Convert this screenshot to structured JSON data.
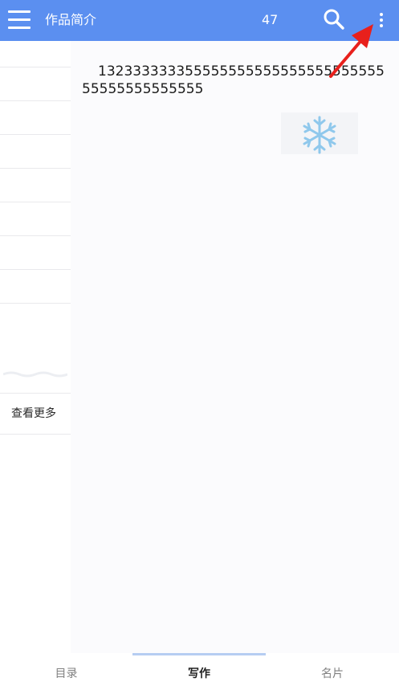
{
  "header": {
    "title": "作品简介",
    "count": "47",
    "menu_icon": "menu-icon",
    "search_icon": "search-icon",
    "more_icon": "more-vertical-icon",
    "bg_color": "#5b8ff0"
  },
  "toc": {
    "more_label": "查看更多",
    "row_count_visible": 8
  },
  "content": {
    "text": "13233333335555555555555555555555555555555555555",
    "decoration_icon": "snowflake-icon",
    "annotation": "red-arrow-pointing-to-more-icon"
  },
  "tabs": [
    {
      "label": "目录",
      "active": false
    },
    {
      "label": "写作",
      "active": true
    },
    {
      "label": "名片",
      "active": false
    }
  ],
  "colors": {
    "accent": "#5b8ff0",
    "tab_active_text": "#1f1f1f",
    "tab_inactive_text": "#808080",
    "arrow": "#e8201c"
  }
}
